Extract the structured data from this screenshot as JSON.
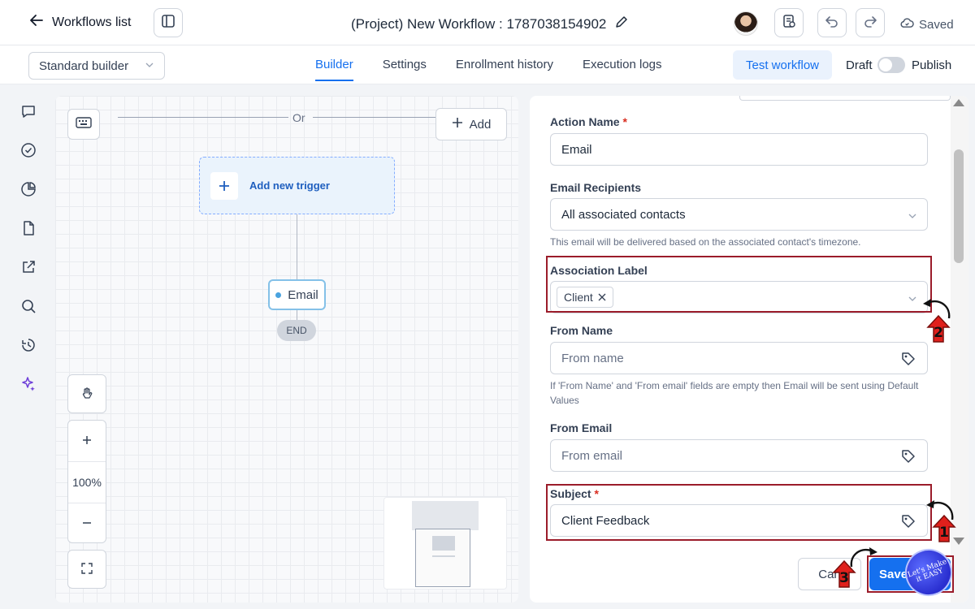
{
  "header": {
    "back_label": "Workflows list",
    "workflow_title": "(Project) New Workflow : 1787038154902",
    "saved_label": "Saved"
  },
  "subheader": {
    "builder_select": "Standard builder",
    "tabs": [
      {
        "label": "Builder",
        "active": true
      },
      {
        "label": "Settings",
        "active": false
      },
      {
        "label": "Enrollment history",
        "active": false
      },
      {
        "label": "Execution logs",
        "active": false
      }
    ],
    "test_button": "Test workflow",
    "draft_label": "Draft",
    "publish_label": "Publish"
  },
  "canvas": {
    "or_label": "Or",
    "add_label": "Add",
    "trigger_label": "Add new trigger",
    "node_label": "Email",
    "end_label": "END",
    "zoom_level": "100%"
  },
  "panel": {
    "action_name": {
      "label": "Action Name",
      "required_mark": "*",
      "value": "Email"
    },
    "recipients": {
      "label": "Email Recipients",
      "value": "All associated contacts",
      "hint": "This email will be delivered based on the associated contact's timezone."
    },
    "association": {
      "label": "Association Label",
      "chip": "Client"
    },
    "from_name": {
      "label": "From Name",
      "placeholder": "From name",
      "hint": "If 'From Name' and 'From email' fields are empty then Email will be sent using Default Values"
    },
    "from_email": {
      "label": "From Email",
      "placeholder": "From email"
    },
    "subject": {
      "label": "Subject",
      "required_mark": "*",
      "value": "Client Feedback"
    },
    "cancel_label": "Can",
    "save_label": "Save"
  },
  "annotations": {
    "step1": "1",
    "step2": "2",
    "step3": "3",
    "watermark": "Let's Make it EASY",
    "highlight_color": "#9b1c2a",
    "accent_color": "#1570ef"
  }
}
